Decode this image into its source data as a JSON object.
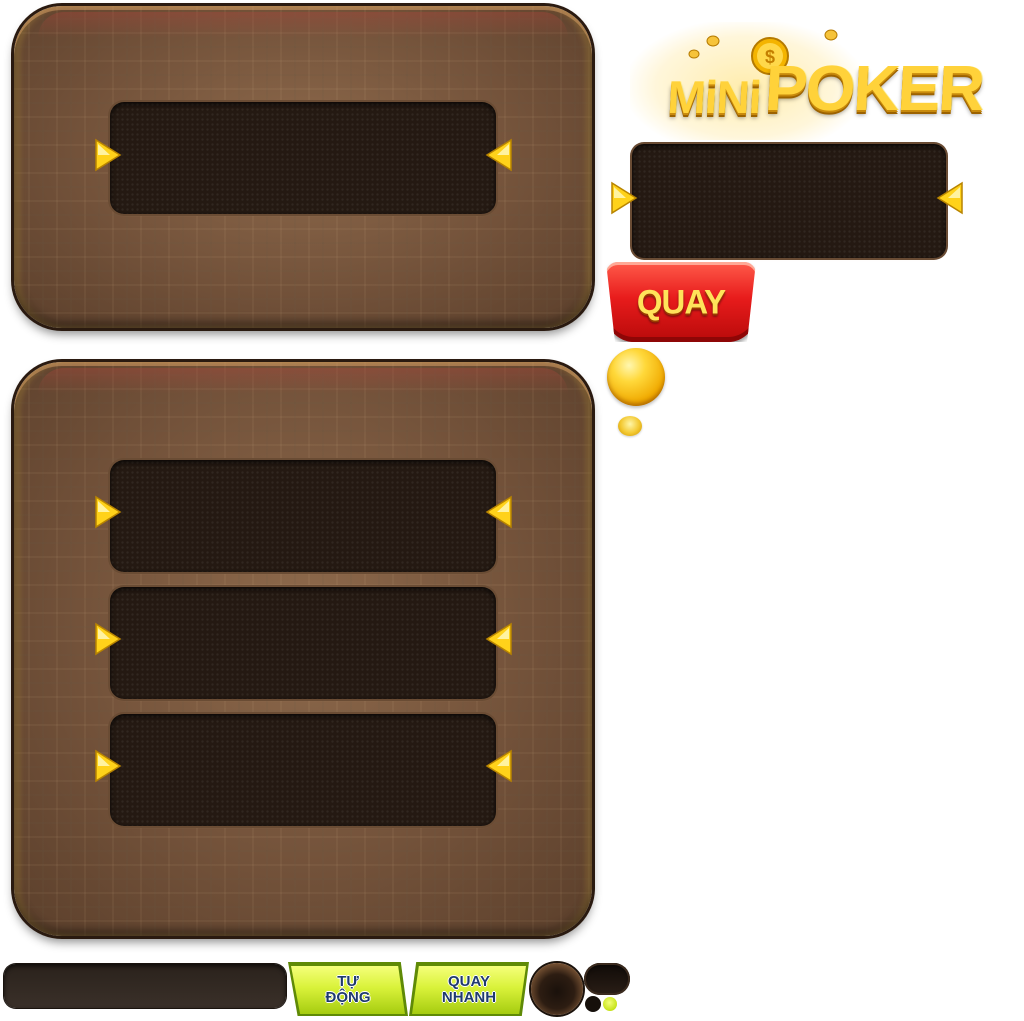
{
  "logo": {
    "mini": "MiNi",
    "poker": "POKER"
  },
  "buttons": {
    "spin": "QUAY",
    "auto_line1": "TỰ",
    "auto_line2": "ĐỘNG",
    "fast_line1": "QUAY",
    "fast_line2": "NHANH"
  },
  "colors": {
    "panel_wood": "#73523a",
    "slot_dark": "#241912",
    "arrow_gold": "#ffd21a",
    "spin_red": "#e81c1c",
    "spin_text": "#ffe35a",
    "green_button": "#d9f23a",
    "green_button_text": "#1f3a6e"
  },
  "icons": {
    "arrow_right": "gold-triangle-right-icon",
    "arrow_left": "gold-triangle-left-icon",
    "coin": "gold-coin-icon"
  }
}
